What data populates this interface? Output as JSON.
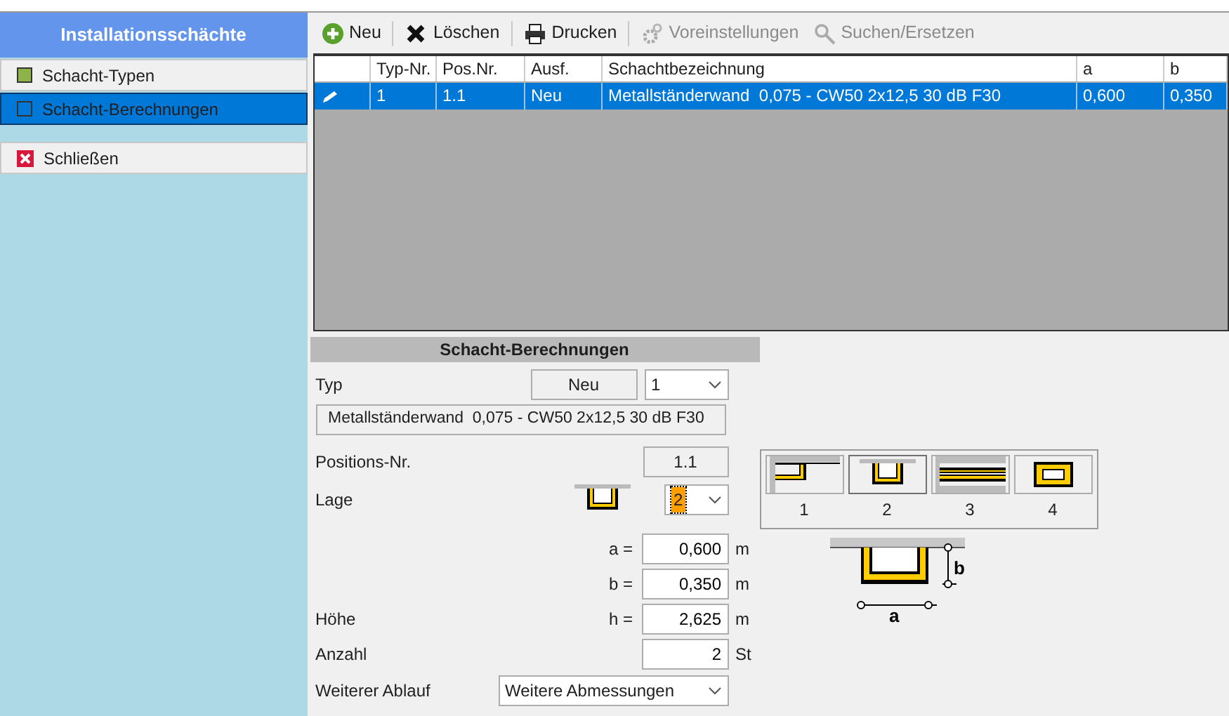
{
  "sidebar": {
    "title": "Installationsschächte",
    "items": [
      {
        "label": "Schacht-Typen",
        "kind": "nav",
        "selected": false
      },
      {
        "label": "Schacht-Berechnungen",
        "kind": "nav",
        "selected": true
      },
      {
        "label": "Schließen",
        "kind": "close",
        "selected": false
      }
    ]
  },
  "toolbar": [
    {
      "label": "Neu",
      "kind": "new",
      "disabled": false
    },
    {
      "label": "Löschen",
      "kind": "delete",
      "disabled": false
    },
    {
      "label": "Drucken",
      "kind": "print",
      "disabled": false
    },
    {
      "label": "Voreinstellungen",
      "kind": "settings",
      "disabled": true
    },
    {
      "label": "Suchen/Ersetzen",
      "kind": "search",
      "disabled": true
    }
  ],
  "table": {
    "columns": [
      "Typ-Nr.",
      "Pos.Nr.",
      "Ausf.",
      "Schachtbezeichnung",
      "a",
      "b"
    ],
    "rows": [
      {
        "selected": true,
        "editing": true,
        "cells": [
          "1",
          "1.1",
          "Neu",
          "Metallständerwand  0,075 - CW50 2x12,5 30 dB F30",
          "0,600",
          "0,350"
        ]
      }
    ]
  },
  "form": {
    "title": "Schacht-Berechnungen",
    "typ": {
      "label": "Typ",
      "status": "Neu",
      "value": "1"
    },
    "description": "Metallständerwand  0,075 - CW50 2x12,5 30 dB F30",
    "position": {
      "label": "Positions-Nr.",
      "value": "1.1"
    },
    "lage": {
      "label": "Lage",
      "value": "2",
      "focused": true,
      "options": [
        {
          "label": "1",
          "kind": "corner",
          "selected": false
        },
        {
          "label": "2",
          "kind": "niche",
          "selected": true
        },
        {
          "label": "3",
          "kind": "through",
          "selected": false
        },
        {
          "label": "4",
          "kind": "free",
          "selected": false
        }
      ]
    },
    "fields": [
      {
        "symbol": "a =",
        "value": "0,600",
        "unit": "m"
      },
      {
        "symbol": "b =",
        "value": "0,350",
        "unit": "m"
      },
      {
        "label": "Höhe",
        "symbol": "h =",
        "value": "2,625",
        "unit": "m"
      },
      {
        "label": "Anzahl",
        "value": "2",
        "unit": "St"
      }
    ],
    "next_step": {
      "label": "Weiterer Ablauf",
      "value": "Weitere Abmessungen"
    },
    "diagram": {
      "label_a": "a",
      "label_b": "b"
    }
  }
}
